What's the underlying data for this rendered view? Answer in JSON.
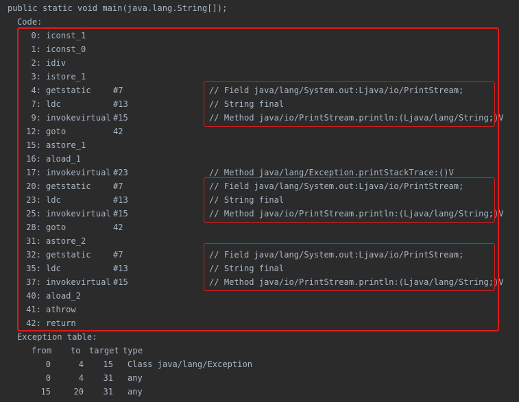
{
  "header": "public static void main(java.lang.String[]);",
  "code_label": "Code:",
  "instructions": [
    {
      "offset": "0:",
      "op": "iconst_1",
      "arg": "",
      "comment": ""
    },
    {
      "offset": "1:",
      "op": "iconst_0",
      "arg": "",
      "comment": ""
    },
    {
      "offset": "2:",
      "op": "idiv",
      "arg": "",
      "comment": ""
    },
    {
      "offset": "3:",
      "op": "istore_1",
      "arg": "",
      "comment": ""
    },
    {
      "offset": "4:",
      "op": "getstatic",
      "arg": "#7",
      "comment": "// Field java/lang/System.out:Ljava/io/PrintStream;"
    },
    {
      "offset": "7:",
      "op": "ldc",
      "arg": "#13",
      "comment": "// String final"
    },
    {
      "offset": "9:",
      "op": "invokevirtual",
      "arg": "#15",
      "comment": "// Method java/io/PrintStream.println:(Ljava/lang/String;)V"
    },
    {
      "offset": "12:",
      "op": "goto",
      "arg": "42",
      "comment": ""
    },
    {
      "offset": "15:",
      "op": "astore_1",
      "arg": "",
      "comment": ""
    },
    {
      "offset": "16:",
      "op": "aload_1",
      "arg": "",
      "comment": ""
    },
    {
      "offset": "17:",
      "op": "invokevirtual",
      "arg": "#23",
      "comment": "// Method java/lang/Exception.printStackTrace:()V"
    },
    {
      "offset": "20:",
      "op": "getstatic",
      "arg": "#7",
      "comment": "// Field java/lang/System.out:Ljava/io/PrintStream;"
    },
    {
      "offset": "23:",
      "op": "ldc",
      "arg": "#13",
      "comment": "// String final"
    },
    {
      "offset": "25:",
      "op": "invokevirtual",
      "arg": "#15",
      "comment": "// Method java/io/PrintStream.println:(Ljava/lang/String;)V"
    },
    {
      "offset": "28:",
      "op": "goto",
      "arg": "42",
      "comment": ""
    },
    {
      "offset": "31:",
      "op": "astore_2",
      "arg": "",
      "comment": ""
    },
    {
      "offset": "32:",
      "op": "getstatic",
      "arg": "#7",
      "comment": "// Field java/lang/System.out:Ljava/io/PrintStream;"
    },
    {
      "offset": "35:",
      "op": "ldc",
      "arg": "#13",
      "comment": "// String final"
    },
    {
      "offset": "37:",
      "op": "invokevirtual",
      "arg": "#15",
      "comment": "// Method java/io/PrintStream.println:(Ljava/lang/String;)V"
    },
    {
      "offset": "40:",
      "op": "aload_2",
      "arg": "",
      "comment": ""
    },
    {
      "offset": "41:",
      "op": "athrow",
      "arg": "",
      "comment": ""
    },
    {
      "offset": "42:",
      "op": "return",
      "arg": "",
      "comment": ""
    }
  ],
  "exception_table": {
    "title": "Exception table:",
    "headers": [
      "from",
      "to",
      "target",
      "type"
    ],
    "rows": [
      [
        "0",
        "4",
        "15",
        "Class java/lang/Exception"
      ],
      [
        "0",
        "4",
        "31",
        "any"
      ],
      [
        "15",
        "20",
        "31",
        "any"
      ]
    ]
  },
  "colors": {
    "background": "#2b2b2b",
    "text": "#a9b7c6",
    "highlight_box": "#e31b1b"
  }
}
